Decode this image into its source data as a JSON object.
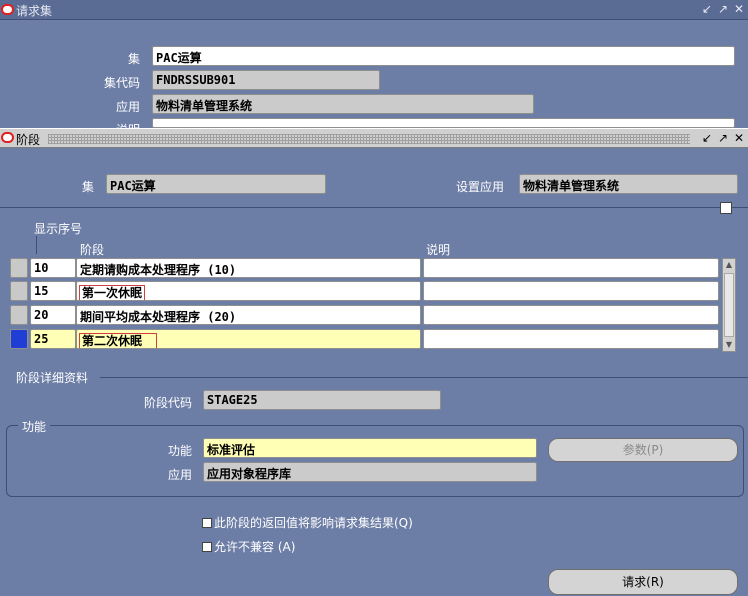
{
  "main_window": {
    "title": "请求集",
    "fields": {
      "set_label": "集",
      "set_value": "PAC运算",
      "set_code_label": "集代码",
      "set_code_value": "FNDRSSUB901",
      "app_label": "应用",
      "app_value": "物料清单管理系统",
      "desc_label": "说明"
    }
  },
  "stage_window": {
    "title": "阶段",
    "header": {
      "set_label": "集",
      "set_value": "PAC运算",
      "setup_app_label": "设置应用",
      "setup_app_value": "物料清单管理系统"
    },
    "table": {
      "display_seq_label": "显示序号",
      "col_stage": "阶段",
      "col_desc": "说明",
      "rows": [
        {
          "seq": "10",
          "stage": "定期请购成本处理程序 (10)",
          "desc": ""
        },
        {
          "seq": "15",
          "stage": "第一次休眠",
          "desc": ""
        },
        {
          "seq": "20",
          "stage": "期间平均成本处理程序 (20)",
          "desc": ""
        },
        {
          "seq": "25",
          "stage": "第二次休眠",
          "desc": ""
        }
      ]
    },
    "detail": {
      "section_label": "阶段详细资料",
      "stage_code_label": "阶段代码",
      "stage_code_value": "STAGE25"
    },
    "function_group": {
      "title": "功能",
      "function_label": "功能",
      "function_value": "标准评估",
      "app_label": "应用",
      "app_value": "应用对象程序库",
      "params_button": "参数(P)"
    },
    "checkboxes": {
      "affects_result": "此阶段的返回值将影响请求集结果(Q)",
      "allow_incompatible": "允许不兼容 (A)"
    },
    "request_button": "请求(R)"
  },
  "colors": {
    "background": "#6d7ea6",
    "active_row": "#1f3ed6",
    "highlight_field": "#ffffb5"
  }
}
